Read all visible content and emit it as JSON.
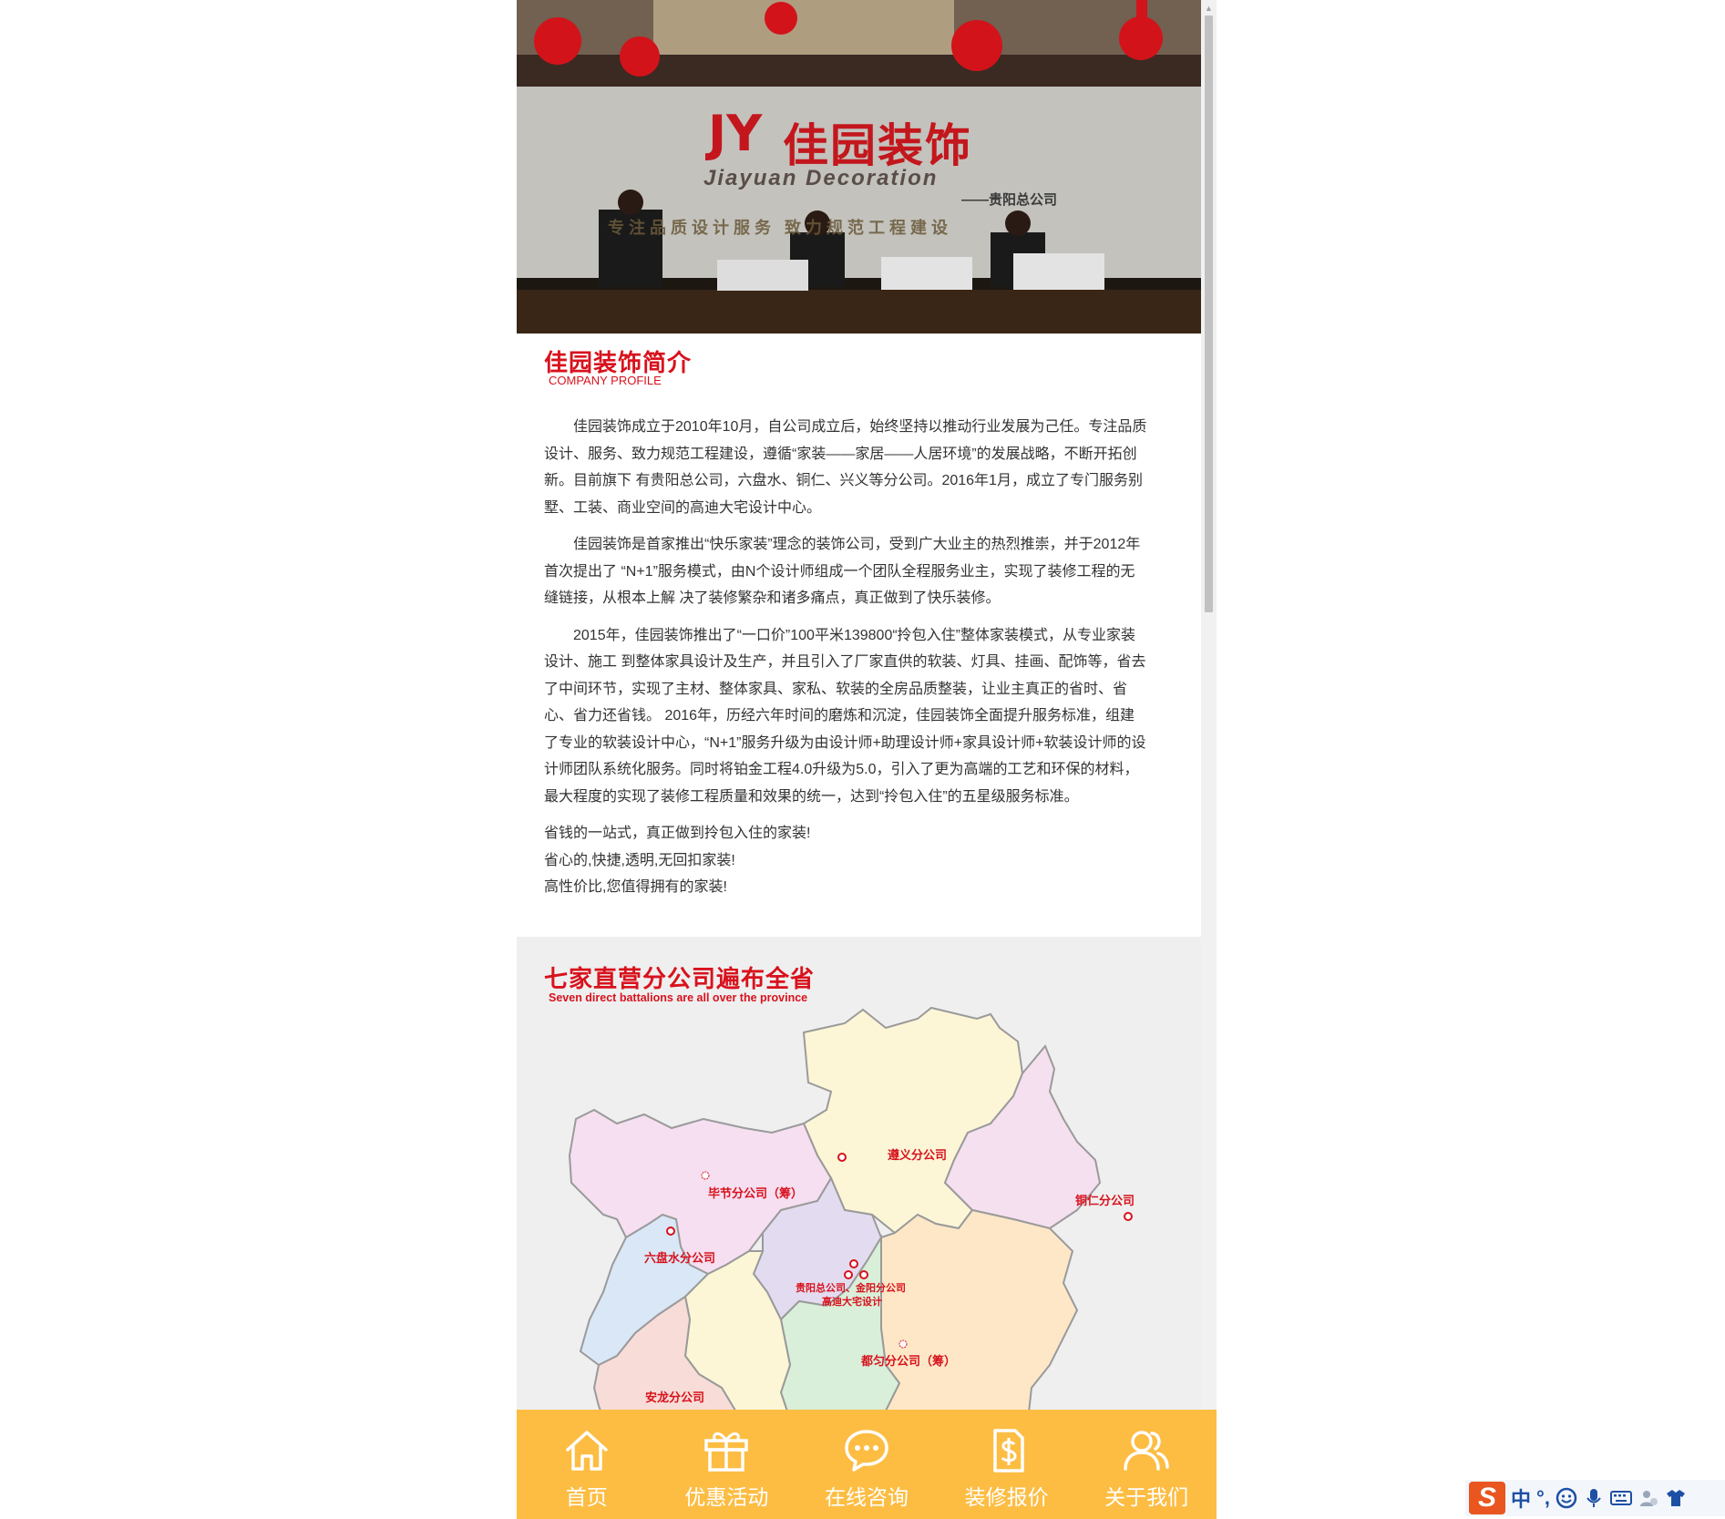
{
  "hero": {
    "brand_cn": "佳园装饰",
    "brand_en": "Jiayuan Decoration",
    "branch": "——贵阳总公司",
    "slogan": "专注品质设计服务 致力规范工程建设"
  },
  "intro": {
    "title": "佳园装饰简介",
    "subtitle": "COMPANY PROFILE",
    "paragraphs": [
      "佳园装饰成立于2010年10月，自公司成立后，始终坚持以推动行业发展为己任。专注品质设计、服务、致力规范工程建设，遵循“家装——家居——人居环境”的发展战略，不断开拓创新。目前旗下 有贵阳总公司，六盘水、铜仁、兴义等分公司。2016年1月，成立了专门服务别墅、工装、商业空间的高迪大宅设计中心。",
      "佳园装饰是首家推出“快乐家装”理念的装饰公司，受到广大业主的热烈推崇，并于2012年首次提出了 “N+1”服务模式，由N个设计师组成一个团队全程服务业主，实现了装修工程的无缝链接，从根本上解 决了装修繁杂和诸多痛点，真正做到了快乐装修。",
      "2015年，佳园装饰推出了“一口价”100平米139800“拎包入住”整体家装模式，从专业家装设计、施工 到整体家具设计及生产，并且引入了厂家直供的软装、灯具、挂画、配饰等，省去了中间环节，实现了主材、整体家具、家私、软装的全房品质整装，让业主真正的省时、省心、省力还省钱。 2016年，历经六年时间的磨炼和沉淀，佳园装饰全面提升服务标准，组建了专业的软装设计中心，“N+1”服务升级为由设计师+助理设计师+家具设计师+软装设计师的设计师团队系统化服务。同时将铂金工程4.0升级为5.0，引入了更为高端的工艺和环保的材料，最大程度的实现了装修工程质量和效果的统一，达到“拎包入住”的五星级服务标准。"
    ],
    "taglines": [
      "省钱的一站式，真正做到拎包入住的家装!",
      "省心的,快捷,透明,无回扣家装!",
      "高性价比,您值得拥有的家装!"
    ]
  },
  "branches": {
    "title": "七家直营分公司遍布全省",
    "subtitle": "Seven direct battalions are all over the province",
    "labels": {
      "zunyi": "遵义分公司",
      "bijie": "毕节分公司（筹）",
      "tongren": "铜仁分公司",
      "liupanshui": "六盘水分公司",
      "guiyang": "贵阳总公司、金阳分公司",
      "gaodi": "高迪大宅设计",
      "duyun": "都匀分公司（筹）",
      "anlong": "安龙分公司"
    }
  },
  "nav": {
    "items": [
      {
        "label": "首页",
        "icon": "home-icon"
      },
      {
        "label": "优惠活动",
        "icon": "gift-icon"
      },
      {
        "label": "在线咨询",
        "icon": "chat-icon"
      },
      {
        "label": "装修报价",
        "icon": "price-tag-icon"
      },
      {
        "label": "关于我们",
        "icon": "users-icon"
      }
    ]
  },
  "ime": {
    "logo": "S",
    "mode": "中",
    "punct": "°,"
  },
  "colors": {
    "accent_red": "#d8121d",
    "nav_bg": "#fdbd43",
    "section_bg": "#efefef"
  }
}
